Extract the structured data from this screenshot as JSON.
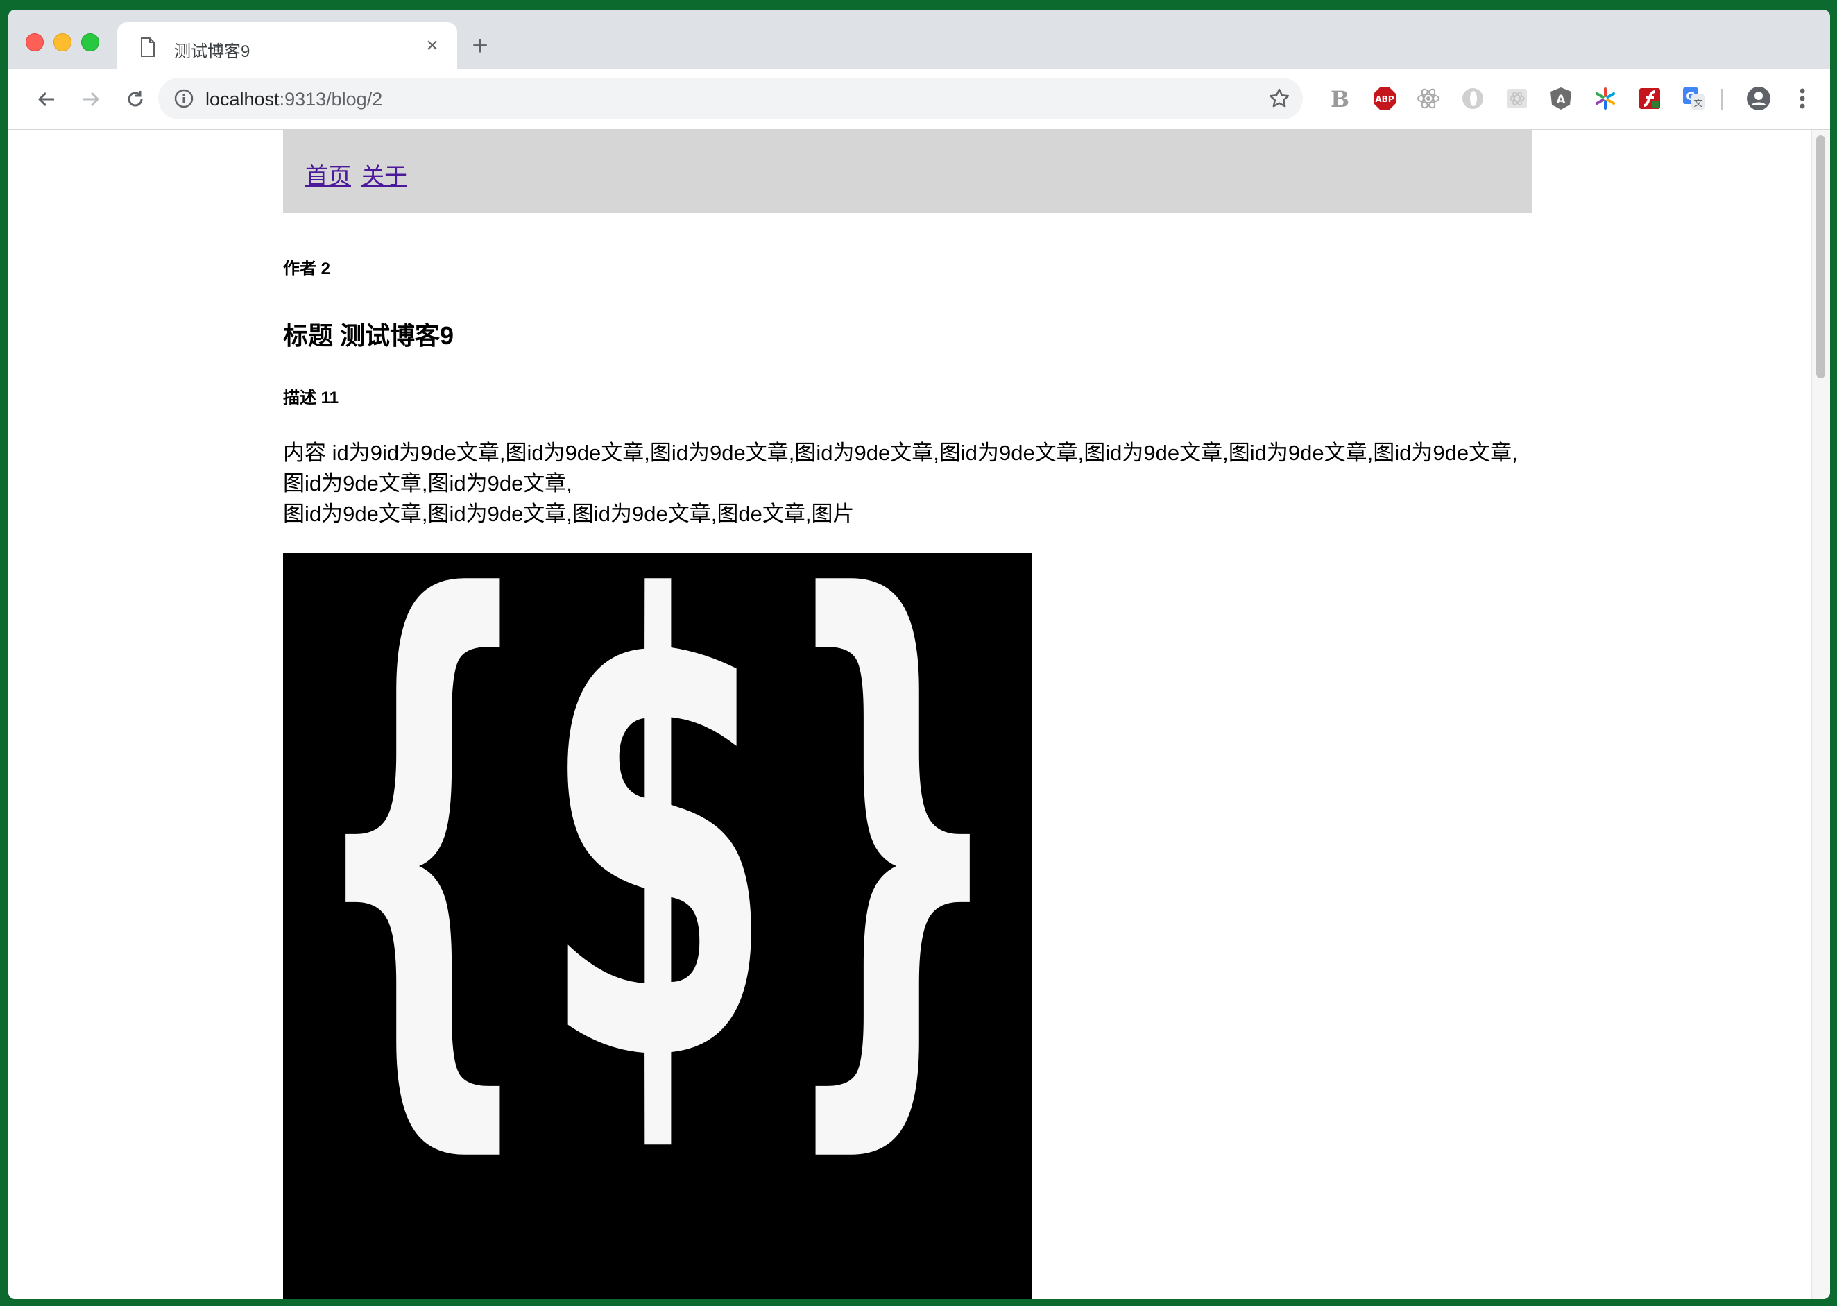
{
  "browser": {
    "tab_title": "测试博客9",
    "url_host": "localhost",
    "url_rest": ":9313/blog/2",
    "extensions": [
      "bootstrap-icon",
      "adblock-icon",
      "react-devtools-icon",
      "opera-icon",
      "extension-icon",
      "angular-icon",
      "pinwheel-icon",
      "flash-icon",
      "translate-icon"
    ]
  },
  "nav": {
    "home": "首页",
    "about": "关于"
  },
  "post": {
    "author": "作者 2",
    "title": "标题 测试博客9",
    "description": "描述 11",
    "content_line1": "内容 id为9id为9de文章,图id为9de文章,图id为9de文章,图id为9de文章,图id为9de文章,图id为9de文章,图id为9de文章,图id为9de文章,图id为9de文章,图id为9de文章,",
    "content_line2": "图id为9de文章,图id为9de文章,图id为9de文章,图de文章,图片",
    "image_logo": "{$}"
  },
  "colors": {
    "nav_bg": "#d6d6d6",
    "link": "#4b1a9a",
    "image_bg": "#000000",
    "image_fg": "#f7f7f7"
  }
}
